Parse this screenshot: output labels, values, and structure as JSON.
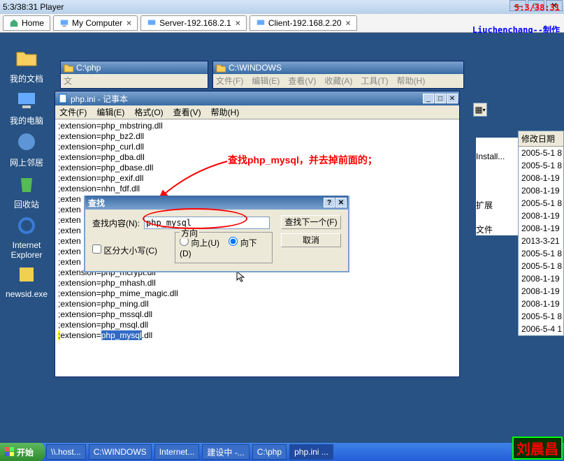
{
  "player": {
    "title": "5:3/38:31 Player"
  },
  "overlay": {
    "time": "5:3/38:31",
    "credit": "Liuchenchang--制作"
  },
  "tabs": [
    {
      "label": "Home",
      "closable": false
    },
    {
      "label": "My Computer",
      "closable": true
    },
    {
      "label": "Server-192.168.2.1",
      "closable": true
    },
    {
      "label": "Client-192.168.2.20",
      "closable": true
    }
  ],
  "desktop_icons": [
    {
      "label": "我的文档",
      "id": "my-documents"
    },
    {
      "label": "我的电脑",
      "id": "my-computer"
    },
    {
      "label": "网上邻居",
      "id": "network"
    },
    {
      "label": "回收站",
      "id": "recycle-bin"
    },
    {
      "label": "Internet Explorer",
      "id": "ie"
    },
    {
      "label": "newsid.exe",
      "id": "newsid"
    }
  ],
  "explorer1": {
    "title": "C:\\php"
  },
  "explorer2": {
    "title": "C:\\WINDOWS",
    "menu": [
      "文件(F)",
      "编辑(E)",
      "查看(V)",
      "收藏(A)",
      "工具(T)",
      "帮助(H)"
    ]
  },
  "right_panel": {
    "header": "修改日期",
    "items_left": [
      "Install...",
      "",
      "",
      "扩展",
      "文件"
    ],
    "items": [
      "2005-5-1 8",
      "2005-5-1 8",
      "2008-1-19",
      "2008-1-19",
      "2005-5-1 8",
      "2008-1-19",
      "2008-1-19",
      "2013-3-21",
      "2005-5-1 8",
      "2005-5-1 8",
      "2008-1-19",
      "2008-1-19",
      "2008-1-19",
      "2005-5-1 8",
      "2006-5-4 1"
    ]
  },
  "notepad": {
    "title": "php.ini - 记事本",
    "menu": [
      "文件(F)",
      "编辑(E)",
      "格式(O)",
      "查看(V)",
      "帮助(H)"
    ],
    "lines": [
      ";extension=php_mbstring.dll",
      ";extension=php_bz2.dll",
      ";extension=php_curl.dll",
      ";extension=php_dba.dll",
      ";extension=php_dbase.dll",
      ";extension=php_exif.dll",
      ";extension=nhn_fdf.dll",
      ";exten",
      ";exten",
      ";exten",
      ";exten",
      ";exten",
      ";exten",
      ";exten",
      ";extension=php_mcrypt.dll",
      ";extension=php_mhash.dll",
      ";extension=php_mime_magic.dll",
      ";extension=php_ming.dll",
      ";extension=php_mssql.dll",
      ";extension=php_msql.dll"
    ],
    "highlighted_prefix": ";",
    "highlighted_mid1": "extension=",
    "highlighted_text": "php_mysql",
    "highlighted_suffix": ".dll"
  },
  "annotation": {
    "text": "查找php_mysql，并去掉前面的；"
  },
  "find": {
    "title": "查找",
    "label": "查找内容(N):",
    "value": "php_mysql",
    "next_btn": "查找下一个(F)",
    "cancel_btn": "取消",
    "case_label": "区分大小写(C)",
    "direction_title": "方向",
    "up_label": "向上(U)",
    "down_label": "向下(D)"
  },
  "taskbar": {
    "start": "开始",
    "items": [
      "\\\\.host...",
      "C:\\WINDOWS",
      "Internet...",
      "建设中 -...",
      "C:\\php",
      "php.ini ..."
    ]
  },
  "signature": "刘晨昌"
}
